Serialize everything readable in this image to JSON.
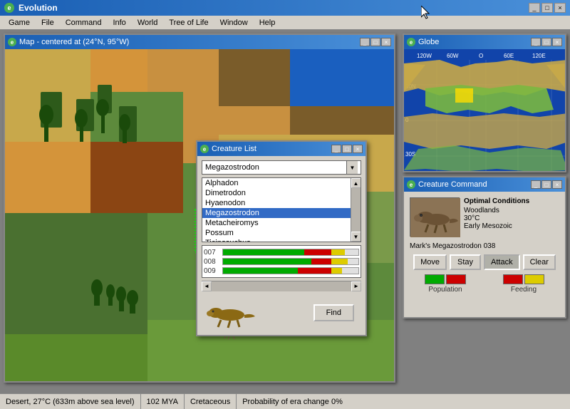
{
  "app": {
    "title": "Evolution",
    "icon": "e"
  },
  "menu": {
    "items": [
      "Game",
      "File",
      "Command",
      "Info",
      "World",
      "Tree of Life",
      "Window",
      "Help"
    ]
  },
  "map_window": {
    "title": "Map - centered at (24°N, 95°W)",
    "controls": [
      "_",
      "□",
      "×"
    ]
  },
  "creature_list_window": {
    "title": "Creature List",
    "controls": [
      "_",
      "□",
      "×"
    ],
    "dropdown_value": "Megazostrodon",
    "list_items": [
      "Alphadon",
      "Dimetrodon",
      "Hyaenodon",
      "Megazostrodon",
      "Metacheiromys",
      "Possum",
      "Ticinosuchus"
    ],
    "selected_item": "Megazostrodon",
    "progress_rows": [
      {
        "label": "007",
        "green": 60,
        "red": 20,
        "yellow": 10
      },
      {
        "label": "008",
        "green": 65,
        "red": 15,
        "yellow": 12
      },
      {
        "label": "009",
        "green": 55,
        "red": 25,
        "yellow": 8
      }
    ],
    "find_button": "Find"
  },
  "globe_window": {
    "title": "Globe",
    "controls": [
      "_",
      "□",
      "×"
    ],
    "axis_labels": {
      "top": [
        "120W",
        "60W",
        "O",
        "60E",
        "120E"
      ],
      "left": [
        "30N",
        "0",
        "30S"
      ]
    }
  },
  "creature_command_window": {
    "title": "Creature Command",
    "controls": [
      "_",
      "□",
      "×"
    ],
    "optimal_conditions_title": "Optimal Conditions",
    "conditions": [
      "Woodlands",
      "30°C",
      "Early Mesozoic"
    ],
    "creature_name": "Mark's Megazostrodon 038",
    "buttons": [
      "Move",
      "Stay",
      "Attack",
      "Clear"
    ],
    "active_button": "Attack",
    "population_label": "Population",
    "feeding_label": "Feeding",
    "population_colors": {
      "green": "#00aa00",
      "red": "#cc0000"
    },
    "feeding_colors": {
      "yellow": "#ddcc00",
      "red": "#cc0000"
    }
  },
  "status_bar": {
    "location": "Desert, 27°C (633m above sea level)",
    "time": "102 MYA",
    "era": "Cretaceous",
    "probability": "Probability of era change 0%"
  }
}
